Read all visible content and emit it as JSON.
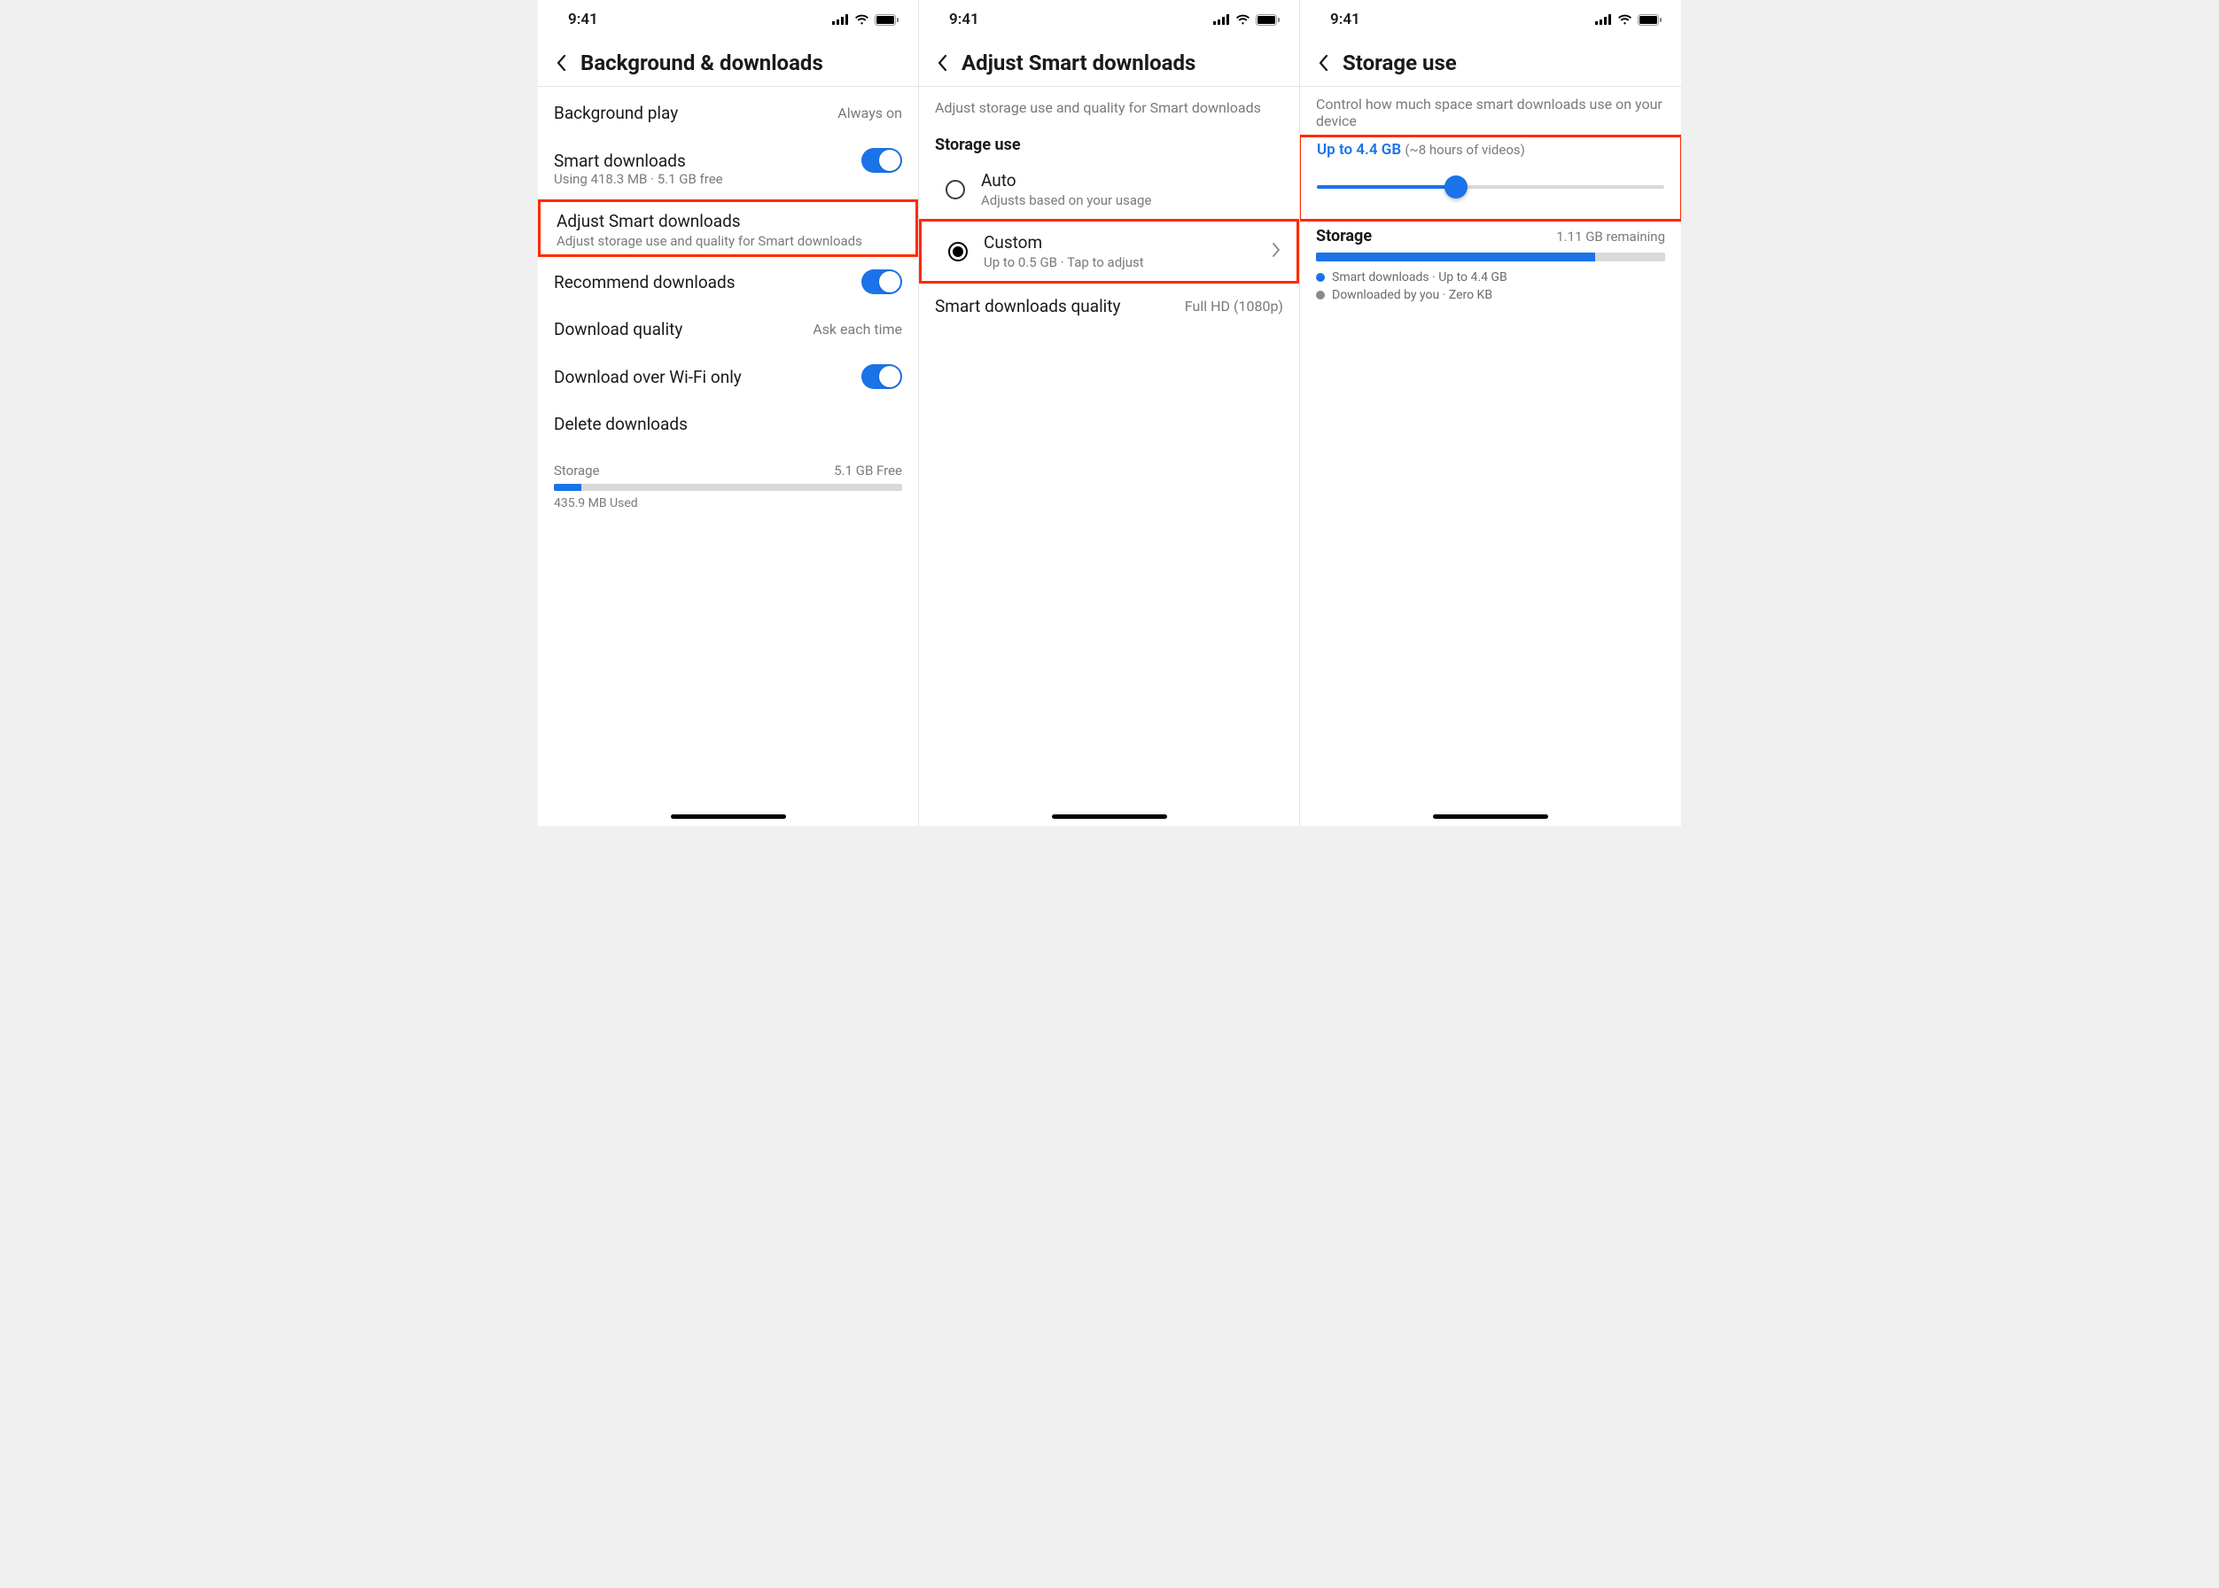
{
  "status": {
    "time": "9:41"
  },
  "s1": {
    "title": "Background & downloads",
    "bg_play": {
      "label": "Background play",
      "value": "Always on"
    },
    "smart": {
      "label": "Smart downloads",
      "sub": "Using 418.3 MB · 5.1 GB free"
    },
    "adjust": {
      "label": "Adjust Smart downloads",
      "sub": "Adjust storage use and quality for Smart downloads"
    },
    "recommend": {
      "label": "Recommend downloads"
    },
    "dl_quality": {
      "label": "Download quality",
      "value": "Ask each time"
    },
    "wifi_only": {
      "label": "Download over Wi-Fi only"
    },
    "delete": {
      "label": "Delete downloads"
    },
    "storage": {
      "label": "Storage",
      "free": "5.1 GB Free",
      "used": "435.9 MB Used",
      "used_pct": 8
    }
  },
  "s2": {
    "title": "Adjust Smart downloads",
    "desc": "Adjust storage use and quality for Smart downloads",
    "section": "Storage use",
    "auto": {
      "label": "Auto",
      "sub": "Adjusts based on your usage"
    },
    "custom": {
      "label": "Custom",
      "sub": "Up to 0.5 GB · Tap to adjust"
    },
    "quality": {
      "label": "Smart downloads quality",
      "value": "Full HD (1080p)"
    }
  },
  "s3": {
    "title": "Storage use",
    "desc": "Control how much space smart downloads use on your device",
    "slider": {
      "value_label": "Up to 4.4 GB ",
      "note": "(~8 hours of videos)",
      "fill_pct": 40
    },
    "storage": {
      "label": "Storage",
      "remaining": "1.11 GB remaining",
      "fill_pct": 80
    },
    "legend1": "Smart downloads · Up to 4.4 GB",
    "legend2": "Downloaded by you · Zero KB"
  }
}
